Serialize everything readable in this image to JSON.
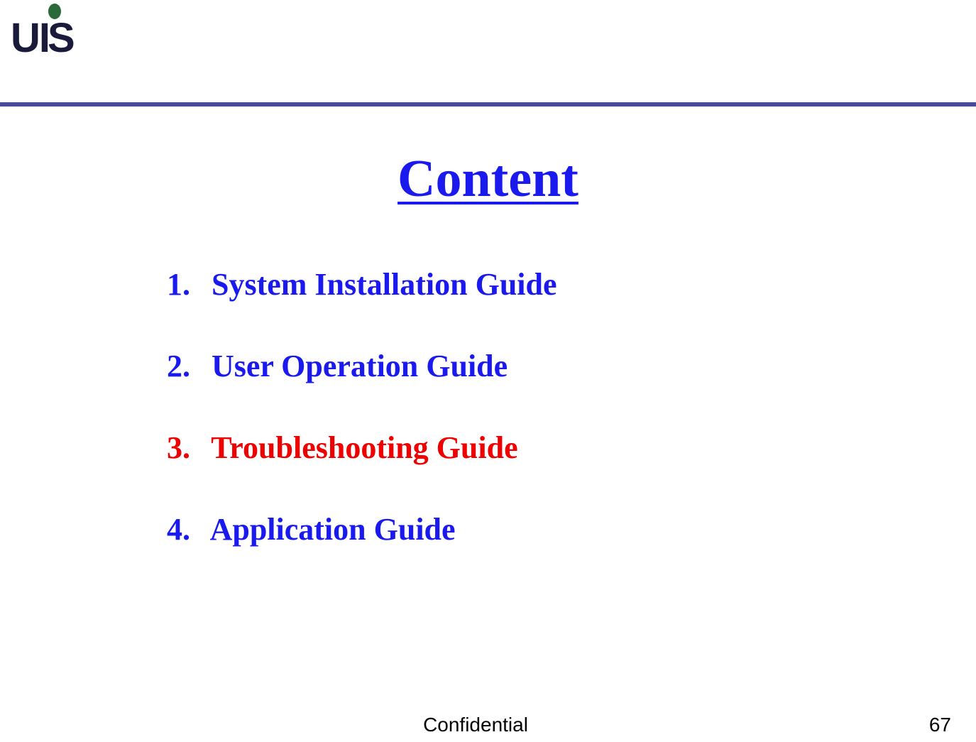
{
  "logo": {
    "letters": "UIS"
  },
  "title": "Content",
  "items": [
    {
      "number": "1.",
      "label": "System Installation Guide",
      "highlighted": false
    },
    {
      "number": "2.",
      "label": "User Operation Guide",
      "highlighted": false
    },
    {
      "number": "3.",
      "label": "Troubleshooting Guide",
      "highlighted": true
    },
    {
      "number": "4.",
      "label": "Application Guide",
      "highlighted": false
    }
  ],
  "footer": {
    "label": "Confidential",
    "page": "67"
  }
}
